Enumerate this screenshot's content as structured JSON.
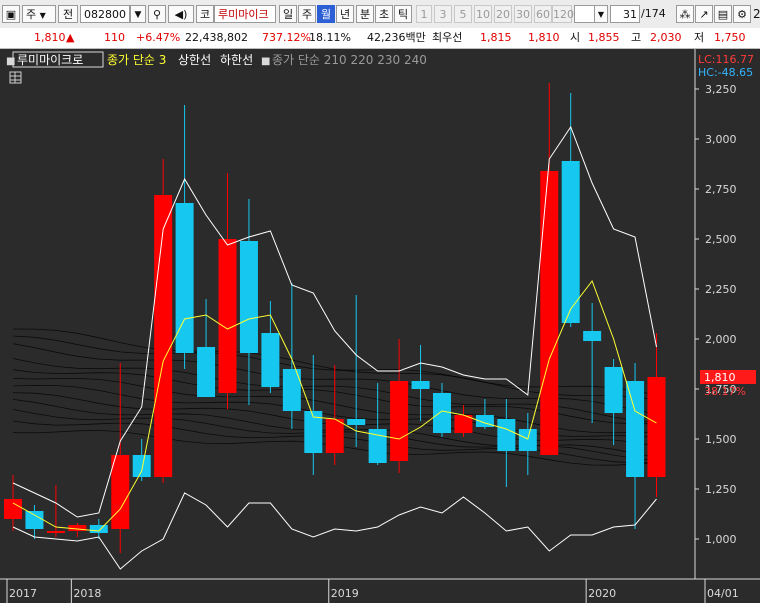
{
  "toolbar": {
    "period_label": "주",
    "market_label": "전",
    "code": "082800",
    "stock_name_btn": "코",
    "stock_name": "루미마이크",
    "tabs": [
      "일",
      "주",
      "월",
      "년",
      "분",
      "초",
      "틱"
    ],
    "active_tab": "월",
    "intervals": [
      "1",
      "3",
      "5",
      "10",
      "20",
      "30",
      "60",
      "120"
    ],
    "page_counter": "31",
    "page_total": "/174",
    "edge_label": "2"
  },
  "quote": {
    "price": "1,810",
    "arrow": "▲",
    "change": "110",
    "change_rate": "+6.47%",
    "volume": "22,438,802",
    "volume_rate": "737.12%",
    "turnover": "18.11%",
    "amount": "42,236백만",
    "best_label": "최우선",
    "best_ask": "1,815",
    "best_bid": "1,810",
    "open_label": "시",
    "open": "1,855",
    "high_label": "고",
    "high": "2,030",
    "low_label": "저",
    "low": "1,750"
  },
  "legend": {
    "stock": "루미마이크로",
    "ma": "종가 단순 3",
    "upper": "상한선",
    "lower": "하한선",
    "ma_long": "종가 단순 210  220  230  240"
  },
  "indicators": {
    "lc": "LC:116.77",
    "hc": "HC:-48.65",
    "last_price": "1,810",
    "last_pct": "38.17%"
  },
  "colors": {
    "up": "#ff0000",
    "down": "#16c8f0",
    "ma3": "#ffff33",
    "envelope": "#ffffff",
    "bg": "#2b2b2b",
    "axis_text": "#d9d9d9"
  },
  "chart_data": {
    "type": "candlestick",
    "ylim": [
      800,
      3450
    ],
    "yticks": [
      1000,
      1250,
      1500,
      1750,
      2000,
      2250,
      2500,
      2750,
      3000,
      3250
    ],
    "ytick_labels": [
      "1,000",
      "1,250",
      "1,500",
      "1,750",
      "2,000",
      "2,250",
      "2,500",
      "2,750",
      "3,000",
      "3,250"
    ],
    "x_labels": [
      {
        "label": "2017",
        "index": 0
      },
      {
        "label": "2018",
        "index": 3
      },
      {
        "label": "2019",
        "index": 15
      },
      {
        "label": "2020",
        "index": 27
      },
      {
        "label": "04/01",
        "index": 32
      }
    ],
    "candles": [
      {
        "o": 1100,
        "h": 1320,
        "l": 1040,
        "c": 1200
      },
      {
        "o": 1140,
        "h": 1170,
        "l": 1000,
        "c": 1050
      },
      {
        "o": 1030,
        "h": 1270,
        "l": 1010,
        "c": 1040
      },
      {
        "o": 1040,
        "h": 1080,
        "l": 1010,
        "c": 1070
      },
      {
        "o": 1070,
        "h": 1100,
        "l": 1000,
        "c": 1030
      },
      {
        "o": 1050,
        "h": 1880,
        "l": 930,
        "c": 1420
      },
      {
        "o": 1420,
        "h": 1500,
        "l": 1290,
        "c": 1310
      },
      {
        "o": 1310,
        "h": 2900,
        "l": 1280,
        "c": 2720
      },
      {
        "o": 2680,
        "h": 3170,
        "l": 1850,
        "c": 1930
      },
      {
        "o": 1960,
        "h": 2200,
        "l": 1720,
        "c": 1710
      },
      {
        "o": 1730,
        "h": 2830,
        "l": 1650,
        "c": 2500
      },
      {
        "o": 2490,
        "h": 2700,
        "l": 1670,
        "c": 1930
      },
      {
        "o": 2030,
        "h": 2190,
        "l": 1730,
        "c": 1760
      },
      {
        "o": 1850,
        "h": 2280,
        "l": 1550,
        "c": 1640
      },
      {
        "o": 1640,
        "h": 1920,
        "l": 1320,
        "c": 1430
      },
      {
        "o": 1430,
        "h": 1870,
        "l": 1370,
        "c": 1600
      },
      {
        "o": 1600,
        "h": 2220,
        "l": 1460,
        "c": 1570
      },
      {
        "o": 1550,
        "h": 1780,
        "l": 1370,
        "c": 1380
      },
      {
        "o": 1390,
        "h": 2000,
        "l": 1330,
        "c": 1790
      },
      {
        "o": 1790,
        "h": 1970,
        "l": 1590,
        "c": 1750
      },
      {
        "o": 1730,
        "h": 1780,
        "l": 1510,
        "c": 1530
      },
      {
        "o": 1530,
        "h": 1670,
        "l": 1510,
        "c": 1620
      },
      {
        "o": 1620,
        "h": 1700,
        "l": 1550,
        "c": 1560
      },
      {
        "o": 1600,
        "h": 1700,
        "l": 1260,
        "c": 1440
      },
      {
        "o": 1550,
        "h": 1630,
        "l": 1320,
        "c": 1440
      },
      {
        "o": 1420,
        "h": 3280,
        "l": 1420,
        "c": 2840
      },
      {
        "o": 2890,
        "h": 3230,
        "l": 2060,
        "c": 2080
      },
      {
        "o": 2040,
        "h": 2180,
        "l": 1580,
        "c": 1990
      },
      {
        "o": 1860,
        "h": 1900,
        "l": 1470,
        "c": 1630
      },
      {
        "o": 1790,
        "h": 1880,
        "l": 1050,
        "c": 1310
      },
      {
        "o": 1310,
        "h": 2030,
        "l": 1210,
        "c": 1810
      }
    ],
    "ma3": [
      1180,
      1120,
      1060,
      1050,
      1040,
      1150,
      1340,
      1890,
      2100,
      2120,
      2050,
      2100,
      2120,
      1900,
      1610,
      1600,
      1540,
      1520,
      1500,
      1560,
      1640,
      1620,
      1580,
      1550,
      1500,
      1900,
      2150,
      2290,
      2000,
      1640,
      1580
    ],
    "envelope_upper": [
      1280,
      1230,
      1180,
      1110,
      1130,
      1490,
      1660,
      2550,
      2800,
      2620,
      2470,
      2510,
      2540,
      2270,
      2230,
      2040,
      1920,
      1840,
      1840,
      1880,
      1860,
      1820,
      1800,
      1800,
      1720,
      2900,
      3060,
      2780,
      2550,
      2510,
      1960
    ],
    "envelope_lower": [
      1060,
      1010,
      1000,
      990,
      1010,
      850,
      940,
      1000,
      1230,
      1170,
      1060,
      1180,
      1180,
      1050,
      1010,
      1050,
      1040,
      1060,
      1120,
      1160,
      1130,
      1210,
      1130,
      1040,
      1060,
      940,
      1020,
      1020,
      1060,
      1070,
      1200
    ],
    "long_ma": [
      {
        "start": 2050,
        "end": 1680
      },
      {
        "start": 2000,
        "end": 1720
      },
      {
        "start": 1960,
        "end": 1640
      },
      {
        "start": 1900,
        "end": 1600
      },
      {
        "start": 1860,
        "end": 1580
      },
      {
        "start": 1820,
        "end": 1520
      },
      {
        "start": 1770,
        "end": 1490
      },
      {
        "start": 1720,
        "end": 1460
      },
      {
        "start": 1680,
        "end": 1420
      },
      {
        "start": 1640,
        "end": 1410
      },
      {
        "start": 1600,
        "end": 1390
      },
      {
        "start": 1550,
        "end": 1370
      }
    ]
  }
}
